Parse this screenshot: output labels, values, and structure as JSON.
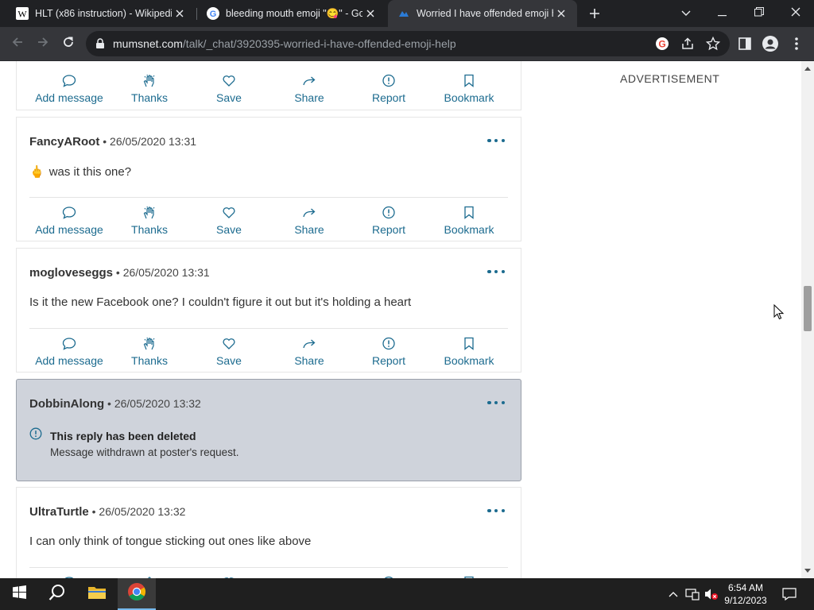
{
  "browser": {
    "tabs": [
      {
        "title": "HLT (x86 instruction) - Wikipedia",
        "favicon": "wikipedia-icon",
        "active": false
      },
      {
        "title": "bleeding mouth emoji \"😋\" - Go",
        "favicon": "google-icon",
        "active": false
      },
      {
        "title": "Worried I have offended emoji h",
        "favicon": "mumsnet-icon",
        "active": true
      }
    ],
    "url_host": "mumsnet.com",
    "url_path": "/talk/_chat/3920395-worried-i-have-offended-emoji-help"
  },
  "page": {
    "advertisement_label": "ADVERTISEMENT",
    "actions": {
      "add_message": "Add message",
      "thanks": "Thanks",
      "save": "Save",
      "share": "Share",
      "report": "Report",
      "bookmark": "Bookmark"
    },
    "posts": [
      {
        "author": "FancyARoot",
        "sep": "•",
        "timestamp": "26/05/2020 13:31",
        "emoji": "🖕",
        "body": "was it this one?"
      },
      {
        "author": "mogloveseggs",
        "sep": "•",
        "timestamp": "26/05/2020 13:31",
        "body": "Is it the new Facebook one? I couldn't figure it out but it's holding a heart"
      },
      {
        "author": "DobbinAlong",
        "sep": "•",
        "timestamp": "26/05/2020 13:32",
        "deleted_title": "This reply has been deleted",
        "deleted_note": "Message withdrawn at poster's request."
      },
      {
        "author": "UltraTurtle",
        "sep": "•",
        "timestamp": "26/05/2020 13:32",
        "body": "I can only think of tongue sticking out ones like above"
      }
    ]
  },
  "taskbar": {
    "time": "6:54 AM",
    "date": "9/12/2023"
  },
  "colors": {
    "accent": "#1c6b8f",
    "deleted_bg": "#cfd3db",
    "chrome_dark": "#202124"
  }
}
